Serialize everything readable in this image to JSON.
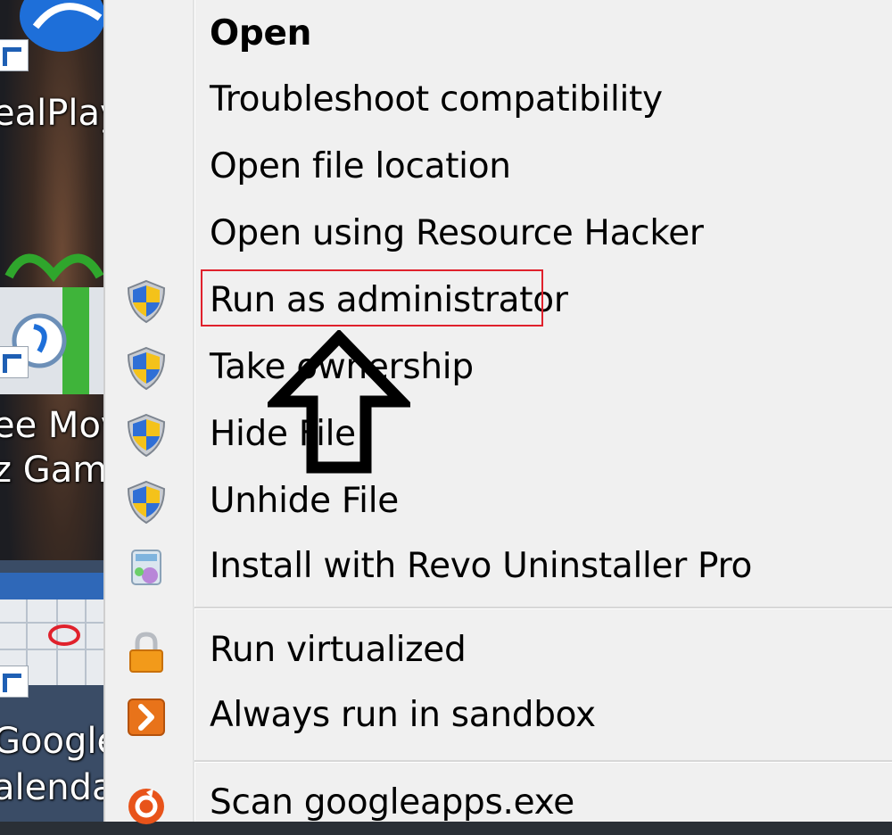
{
  "desktop": {
    "icons": [
      {
        "name": "realplayer",
        "label": "ealPlay"
      },
      {
        "name": "free-movie-games",
        "label": "ee Mov",
        "label2": "z Game"
      },
      {
        "name": "google-calendar",
        "label": "Google",
        "label2": "alenda"
      }
    ]
  },
  "menu": {
    "items": [
      {
        "label": "Open",
        "bold": true,
        "icon": "none"
      },
      {
        "label": "Troubleshoot compatibility",
        "icon": "none"
      },
      {
        "label": "Open file location",
        "icon": "none"
      },
      {
        "label": "Open using Resource Hacker",
        "icon": "none"
      },
      {
        "label": "Run as administrator",
        "icon": "uac-shield-icon",
        "highlighted": true
      },
      {
        "label": "Take ownership",
        "icon": "uac-shield-icon"
      },
      {
        "label": "Hide File",
        "icon": "uac-shield-icon"
      },
      {
        "label": "Unhide File",
        "icon": "uac-shield-icon"
      },
      {
        "label": "Install with Revo Uninstaller Pro",
        "icon": "revo-uninstaller-icon"
      },
      {
        "label": "Run virtualized",
        "icon": "lock-icon"
      },
      {
        "label": "Always run in sandbox",
        "icon": "sandbox-arrow-icon"
      },
      {
        "label": "Scan googleapps.exe",
        "icon": "antivirus-scan-icon"
      }
    ]
  },
  "annotation": {
    "highlight_color": "#e0212c",
    "arrow": "up-arrow-outline-icon"
  },
  "colors": {
    "menu_bg": "#f0f0f0",
    "text": "#000000",
    "shield_blue": "#2f6fd6",
    "shield_yellow": "#f4c21a",
    "lock_orange": "#f29a1a",
    "sandbox_orange": "#e8731a"
  }
}
